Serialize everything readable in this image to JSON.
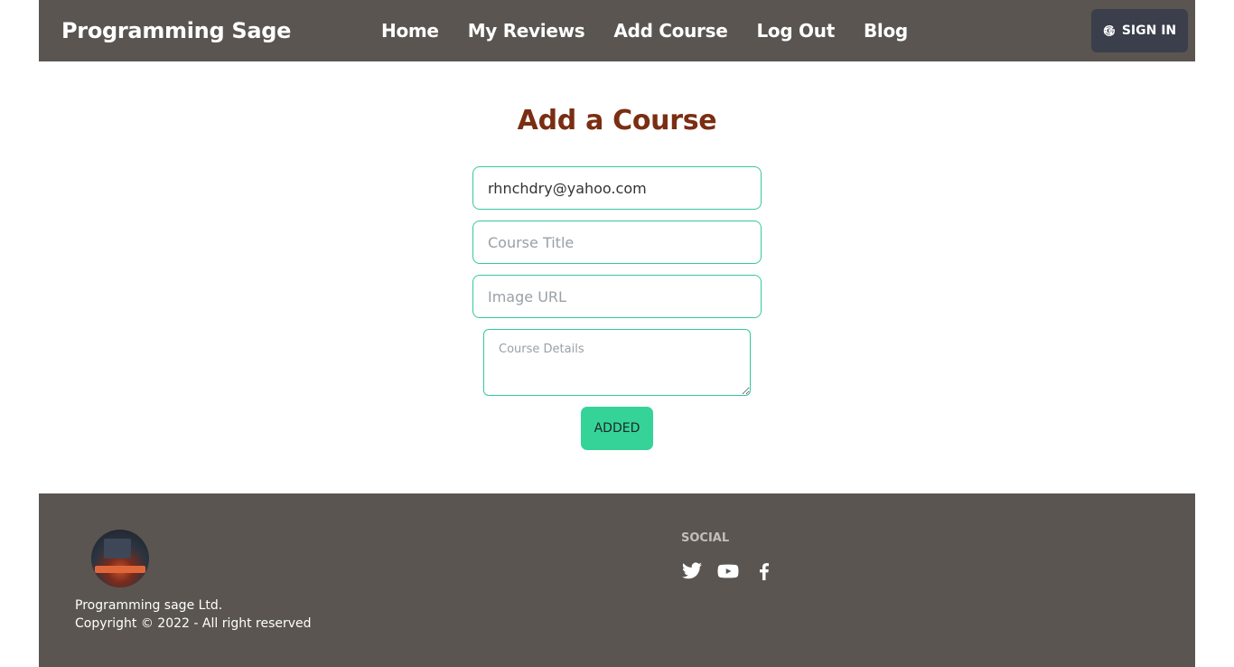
{
  "navbar": {
    "brand": "Programming Sage",
    "links": [
      "Home",
      "My Reviews",
      "Add Course",
      "Log Out",
      "Blog"
    ],
    "signin_label": "SIGN IN"
  },
  "form": {
    "title": "Add a Course",
    "email_value": "rhnchdry@yahoo.com",
    "course_title_placeholder": "Course Title",
    "image_url_placeholder": "Image URL",
    "details_placeholder": "Course Details",
    "submit_label": "ADDED"
  },
  "footer": {
    "company_line1": "Programming sage Ltd.",
    "company_line2": "Copyright © 2022 - All right reserved",
    "social_title": "SOCIAL",
    "social_icons": [
      "twitter-icon",
      "youtube-icon",
      "facebook-icon"
    ]
  },
  "colors": {
    "navbar_bg": "#5a5550",
    "title": "#7a2e12",
    "accent": "#36d399",
    "field_border": "#36c7a0",
    "signin_bg": "#3a3f4b"
  }
}
